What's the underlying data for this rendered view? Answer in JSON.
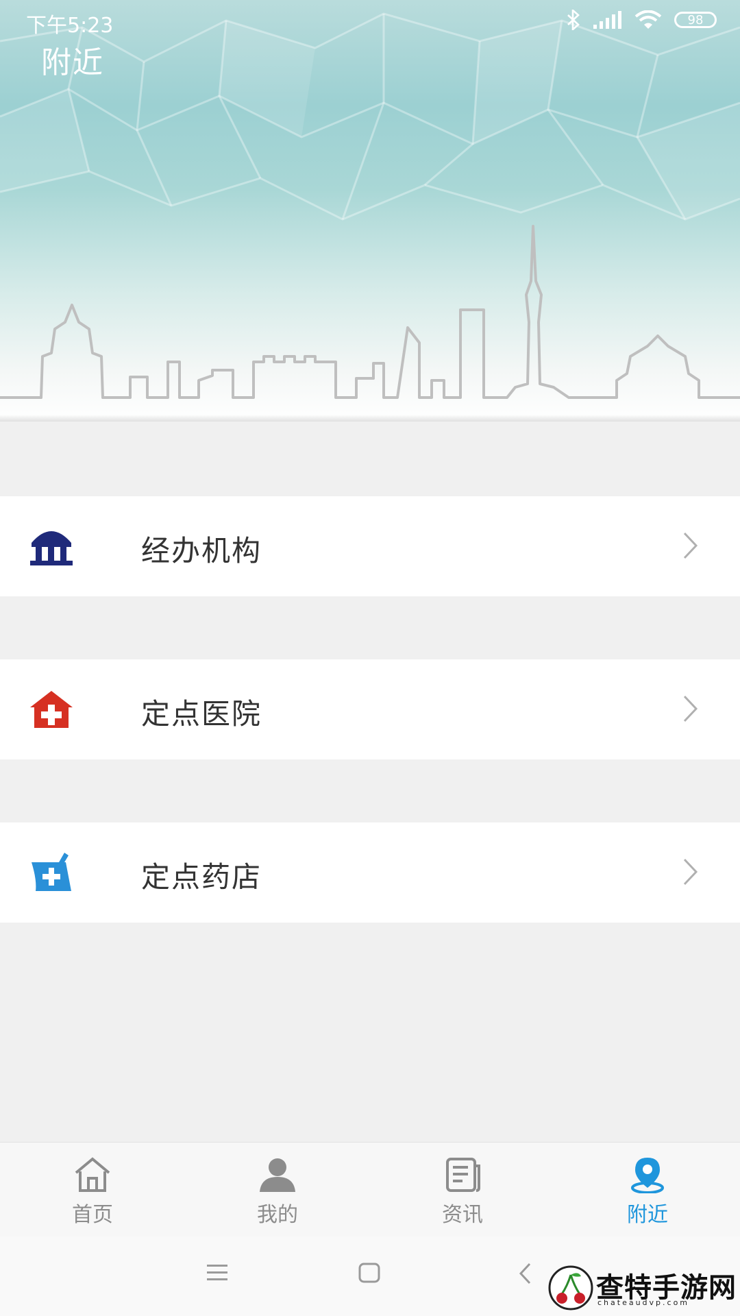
{
  "status_bar": {
    "time": "下午5:23",
    "battery": "98"
  },
  "page": {
    "title": "附近"
  },
  "menu": {
    "items": [
      {
        "label": "经办机构",
        "icon": "institution-icon",
        "color": "#1f2a7a"
      },
      {
        "label": "定点医院",
        "icon": "hospital-icon",
        "color": "#d63022"
      },
      {
        "label": "定点药店",
        "icon": "pharmacy-icon",
        "color": "#2a90d8"
      }
    ]
  },
  "tabbar": {
    "tabs": [
      {
        "label": "首页",
        "icon": "home-icon",
        "active": false
      },
      {
        "label": "我的",
        "icon": "user-icon",
        "active": false
      },
      {
        "label": "资讯",
        "icon": "news-icon",
        "active": false
      },
      {
        "label": "附近",
        "icon": "location-pin-icon",
        "active": true
      }
    ],
    "active_color": "#1f96dc",
    "inactive_color": "#8c8c8c"
  },
  "watermark": {
    "text": "查特手游网",
    "sub": "chateaudvp.com"
  }
}
